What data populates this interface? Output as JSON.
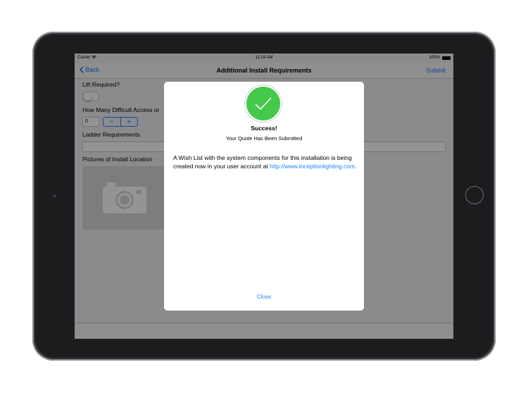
{
  "status_bar": {
    "carrier": "Carrier",
    "time": "11:24 AM",
    "battery": "100%"
  },
  "nav_bar": {
    "back_label": "Back",
    "title": "Additional Install Requirements",
    "submit_label": "Submit"
  },
  "form": {
    "lift_required_label": "Lift Required?",
    "difficult_access_label": "How Many Difficult Access or",
    "difficult_access_value": "0",
    "stepper_minus": "−",
    "stepper_plus": "+",
    "ladder_label": "Ladder Requirements",
    "pictures_label": "Pictures of Install Location"
  },
  "modal": {
    "title": "Success!",
    "subtitle": "Your Quote Has Been Submitted",
    "message_text": "A Wish List with the system components for this installation is being created now in your user account at ",
    "message_link": "http://www.inceptionlighting.com",
    "message_end": ".",
    "close_label": "Close"
  },
  "icons": [
    "wifi-icon",
    "battery-icon",
    "chevron-left-icon",
    "camera-icon",
    "checkmark-icon"
  ],
  "colors": {
    "accent": "#1a82fb",
    "success": "#45c94a",
    "device": "#1c1c1e"
  }
}
